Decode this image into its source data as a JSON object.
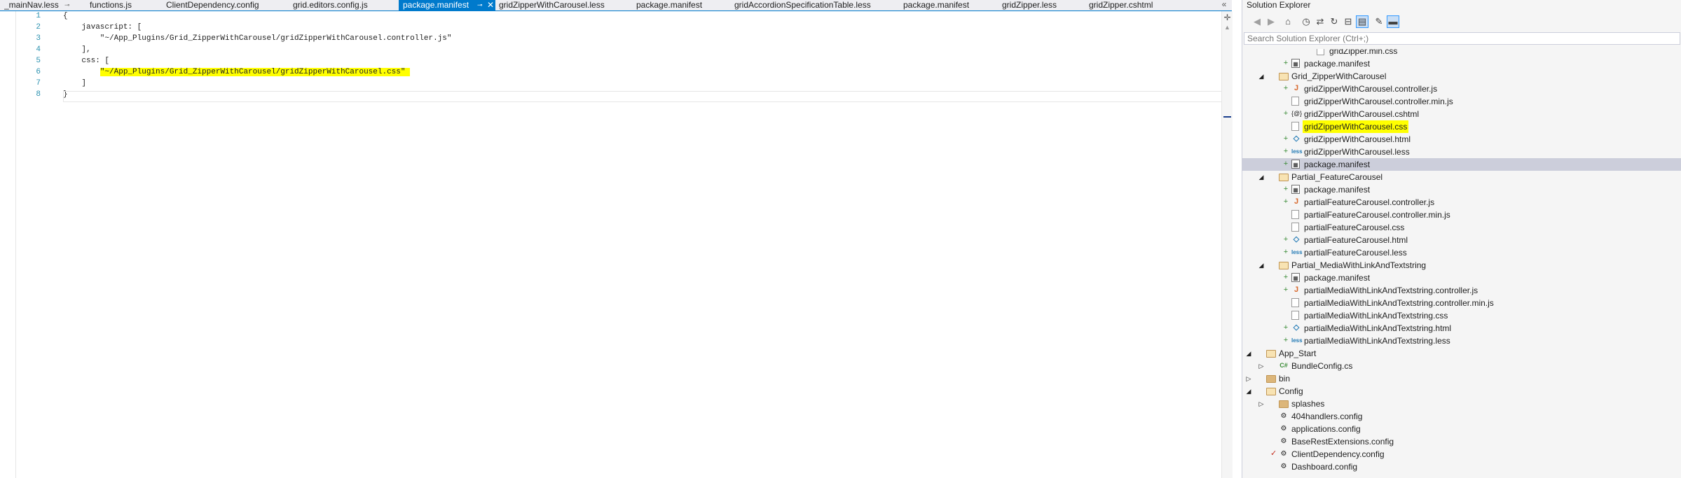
{
  "tabs": [
    {
      "label": "_mainNav.less",
      "pinned": true
    },
    {
      "label": "functions.js",
      "pinned": false
    },
    {
      "label": "ClientDependency.config",
      "pinned": false
    },
    {
      "label": "grid.editors.config.js",
      "pinned": false
    },
    {
      "label": "package.manifest",
      "pinned": true,
      "active": true,
      "close_icon": "✕"
    },
    {
      "label": "gridZipperWithCarousel.less",
      "pinned": false
    },
    {
      "label": "package.manifest",
      "pinned": false
    },
    {
      "label": "gridAccordionSpecificationTable.less",
      "pinned": false
    },
    {
      "label": "package.manifest",
      "pinned": false
    },
    {
      "label": "gridZipper.less",
      "pinned": false
    },
    {
      "label": "gridZipper.cshtml",
      "pinned": false
    }
  ],
  "tab_overflow_icon": "chevrons-left-icon",
  "editor": {
    "lines": [
      {
        "num": "1",
        "text": "{"
      },
      {
        "num": "2",
        "text": "    javascript: ["
      },
      {
        "num": "3",
        "text": "        \"~/App_Plugins/Grid_ZipperWithCarousel/gridZipperWithCarousel.controller.js\""
      },
      {
        "num": "4",
        "text": "    ],"
      },
      {
        "num": "5",
        "text": "    css: ["
      },
      {
        "num": "6",
        "text": "        \"~/App_Plugins/Grid_ZipperWithCarousel/gridZipperWithCarousel.css\"",
        "highlight": true
      },
      {
        "num": "7",
        "text": "    ]"
      },
      {
        "num": "8",
        "text": "}"
      }
    ]
  },
  "solution_explorer": {
    "title": "Solution Explorer",
    "search_placeholder": "Search Solution Explorer (Ctrl+;)",
    "toolbar": [
      {
        "icon": "back-icon",
        "glyph": "◀",
        "enabled": false
      },
      {
        "icon": "forward-icon",
        "glyph": "▶",
        "enabled": false
      },
      {
        "icon": "home-icon",
        "glyph": "⌂",
        "enabled": true
      },
      {
        "icon": "pending-changes-icon",
        "glyph": "◷",
        "enabled": true
      },
      {
        "icon": "sync-icon",
        "glyph": "⇄",
        "enabled": true
      },
      {
        "icon": "refresh-icon",
        "glyph": "↻",
        "enabled": true
      },
      {
        "icon": "collapse-all-icon",
        "glyph": "⊟",
        "enabled": true
      },
      {
        "icon": "show-all-files-icon",
        "glyph": "▤",
        "enabled": true,
        "toggled": true
      },
      {
        "icon": "properties-icon",
        "glyph": "✎",
        "enabled": true
      },
      {
        "icon": "preview-icon",
        "glyph": "▬",
        "enabled": true,
        "toggled": true
      }
    ],
    "tree": [
      {
        "label": "gridZipper.min.css",
        "level": 5,
        "icon": "doc",
        "glyph": ""
      },
      {
        "label": "package.manifest",
        "level": 4,
        "icon": "manifest",
        "glyph": "▦",
        "plus": true
      },
      {
        "label": "Grid_ZipperWithCarousel",
        "level": 3,
        "icon": "folder",
        "glyph": "",
        "expanded": true
      },
      {
        "label": "gridZipperWithCarousel.controller.js",
        "level": 4,
        "icon": "js",
        "glyph": "J",
        "plus": true
      },
      {
        "label": "gridZipperWithCarousel.controller.min.js",
        "level": 4,
        "icon": "doc",
        "glyph": ""
      },
      {
        "label": "gridZipperWithCarousel.cshtml",
        "level": 4,
        "icon": "cshtml",
        "glyph": "{@}",
        "plus": true
      },
      {
        "label": "gridZipperWithCarousel.css",
        "level": 4,
        "icon": "doc",
        "glyph": "",
        "highlight": true
      },
      {
        "label": "gridZipperWithCarousel.html",
        "level": 4,
        "icon": "html",
        "glyph": "◇",
        "plus": true
      },
      {
        "label": "gridZipperWithCarousel.less",
        "level": 4,
        "icon": "less",
        "glyph": "less",
        "plus": true
      },
      {
        "label": "package.manifest",
        "level": 4,
        "icon": "manifest",
        "glyph": "▦",
        "plus": true,
        "selected": true
      },
      {
        "label": "Partial_FeatureCarousel",
        "level": 3,
        "icon": "folder",
        "glyph": "",
        "expanded": true
      },
      {
        "label": "package.manifest",
        "level": 4,
        "icon": "manifest",
        "glyph": "▦",
        "plus": true
      },
      {
        "label": "partialFeatureCarousel.controller.js",
        "level": 4,
        "icon": "js",
        "glyph": "J",
        "plus": true
      },
      {
        "label": "partialFeatureCarousel.controller.min.js",
        "level": 4,
        "icon": "doc",
        "glyph": ""
      },
      {
        "label": "partialFeatureCarousel.css",
        "level": 4,
        "icon": "doc",
        "glyph": ""
      },
      {
        "label": "partialFeatureCarousel.html",
        "level": 4,
        "icon": "html",
        "glyph": "◇",
        "plus": true
      },
      {
        "label": "partialFeatureCarousel.less",
        "level": 4,
        "icon": "less",
        "glyph": "less",
        "plus": true
      },
      {
        "label": "Partial_MediaWithLinkAndTextstring",
        "level": 3,
        "icon": "folder",
        "glyph": "",
        "expanded": true
      },
      {
        "label": "package.manifest",
        "level": 4,
        "icon": "manifest",
        "glyph": "▦",
        "plus": true
      },
      {
        "label": "partialMediaWithLinkAndTextstring.controller.js",
        "level": 4,
        "icon": "js",
        "glyph": "J",
        "plus": true
      },
      {
        "label": "partialMediaWithLinkAndTextstring.controller.min.js",
        "level": 4,
        "icon": "doc",
        "glyph": ""
      },
      {
        "label": "partialMediaWithLinkAndTextstring.css",
        "level": 4,
        "icon": "doc",
        "glyph": ""
      },
      {
        "label": "partialMediaWithLinkAndTextstring.html",
        "level": 4,
        "icon": "html",
        "glyph": "◇",
        "plus": true
      },
      {
        "label": "partialMediaWithLinkAndTextstring.less",
        "level": 4,
        "icon": "less",
        "glyph": "less",
        "plus": true
      },
      {
        "label": "App_Start",
        "level": 2,
        "icon": "folder",
        "glyph": "",
        "expanded": true
      },
      {
        "label": "BundleConfig.cs",
        "level": 3,
        "icon": "cs",
        "glyph": "C#",
        "collapsed": true
      },
      {
        "label": "bin",
        "level": 2,
        "icon": "folder-closed",
        "glyph": "",
        "collapsed": true
      },
      {
        "label": "Config",
        "level": 2,
        "icon": "folder",
        "glyph": "",
        "expanded": true
      },
      {
        "label": "splashes",
        "level": 3,
        "icon": "folder-closed",
        "glyph": "",
        "collapsed": true
      },
      {
        "label": "404handlers.config",
        "level": 3,
        "icon": "config",
        "glyph": "⚙"
      },
      {
        "label": "applications.config",
        "level": 3,
        "icon": "config",
        "glyph": "⚙"
      },
      {
        "label": "BaseRestExtensions.config",
        "level": 3,
        "icon": "config",
        "glyph": "⚙"
      },
      {
        "label": "ClientDependency.config",
        "level": 3,
        "icon": "config",
        "glyph": "⚙",
        "checked": true
      },
      {
        "label": "Dashboard.config",
        "level": 3,
        "icon": "config",
        "glyph": "⚙"
      }
    ]
  },
  "colors": {
    "accent": "#007acc",
    "highlight": "#ffff00",
    "line_number": "#2b91af",
    "selection": "#cccedb"
  }
}
